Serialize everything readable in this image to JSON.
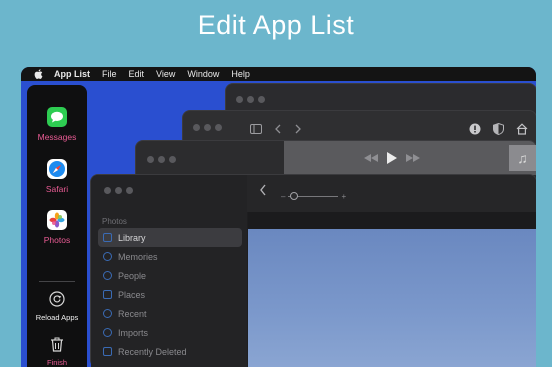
{
  "headline": "Edit App List",
  "menubar": {
    "app_name": "App List",
    "items": [
      "File",
      "Edit",
      "View",
      "Window",
      "Help"
    ]
  },
  "dock": {
    "apps": [
      {
        "label": "Messages",
        "icon": "messages-icon"
      },
      {
        "label": "Safari",
        "icon": "safari-icon"
      },
      {
        "label": "Photos",
        "icon": "photos-icon"
      }
    ],
    "reload_label": "Reload Apps",
    "finish_label": "Finish"
  },
  "photos": {
    "section": "Photos",
    "items": [
      "Library",
      "Memories",
      "People",
      "Places",
      "Recent",
      "Imports",
      "Recently Deleted"
    ],
    "selected": "Library"
  },
  "colors": {
    "background": "#6cb6cc",
    "desktop": "#2a4fd0",
    "dock_label": "#ea5c95"
  }
}
